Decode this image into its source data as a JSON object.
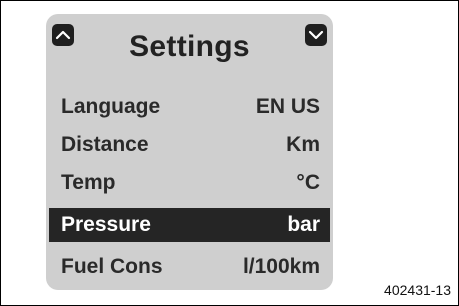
{
  "screen": {
    "title": "Settings",
    "nav": {
      "up_icon": "chevron-up-icon",
      "down_icon": "chevron-down-icon"
    },
    "items": [
      {
        "label": "Language",
        "value": "EN US",
        "selected": false
      },
      {
        "label": "Distance",
        "value": "Km",
        "selected": false
      },
      {
        "label": "Temp",
        "value": "°C",
        "selected": false
      },
      {
        "label": "Pressure",
        "value": "bar",
        "selected": true
      },
      {
        "label": "Fuel Cons",
        "value": "l/100km",
        "selected": false
      }
    ]
  },
  "figure_code": "402431-13"
}
